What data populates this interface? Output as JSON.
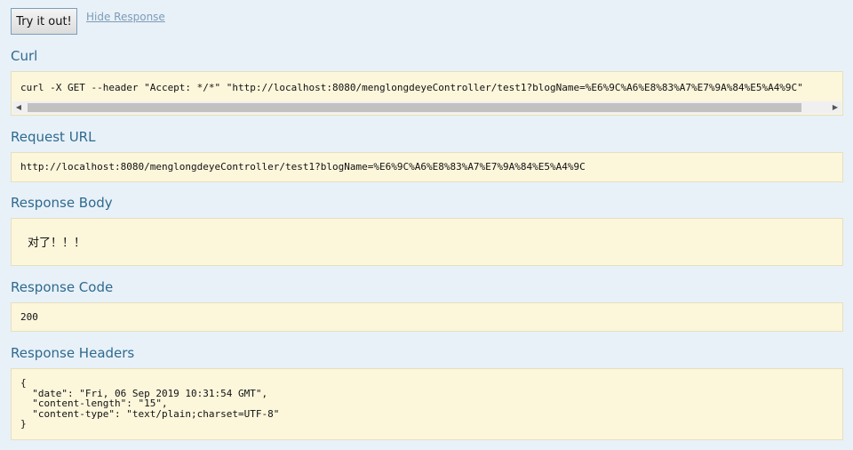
{
  "actions": {
    "try_button": "Try it out!",
    "hide_response": "Hide Response"
  },
  "curl": {
    "title": "Curl",
    "command": "curl -X GET --header \"Accept: */*\" \"http://localhost:8080/menglongdeyeController/test1?blogName=%E6%9C%A6%E8%83%A7%E7%9A%84%E5%A4%9C\""
  },
  "request_url": {
    "title": "Request URL",
    "value": "http://localhost:8080/menglongdeyeController/test1?blogName=%E6%9C%A6%E8%83%A7%E7%9A%84%E5%A4%9C"
  },
  "response_body": {
    "title": "Response Body",
    "value": "对了！！！"
  },
  "response_code": {
    "title": "Response Code",
    "value": "200"
  },
  "response_headers": {
    "title": "Response Headers",
    "value": "{\n  \"date\": \"Fri, 06 Sep 2019 10:31:54 GMT\",\n  \"content-length\": \"15\",\n  \"content-type\": \"text/plain;charset=UTF-8\"\n}"
  },
  "colors": {
    "background": "#e8f1f8",
    "section_title": "#2f6a8f",
    "code_block": "#fcf6db",
    "link": "#7e9bb6"
  }
}
